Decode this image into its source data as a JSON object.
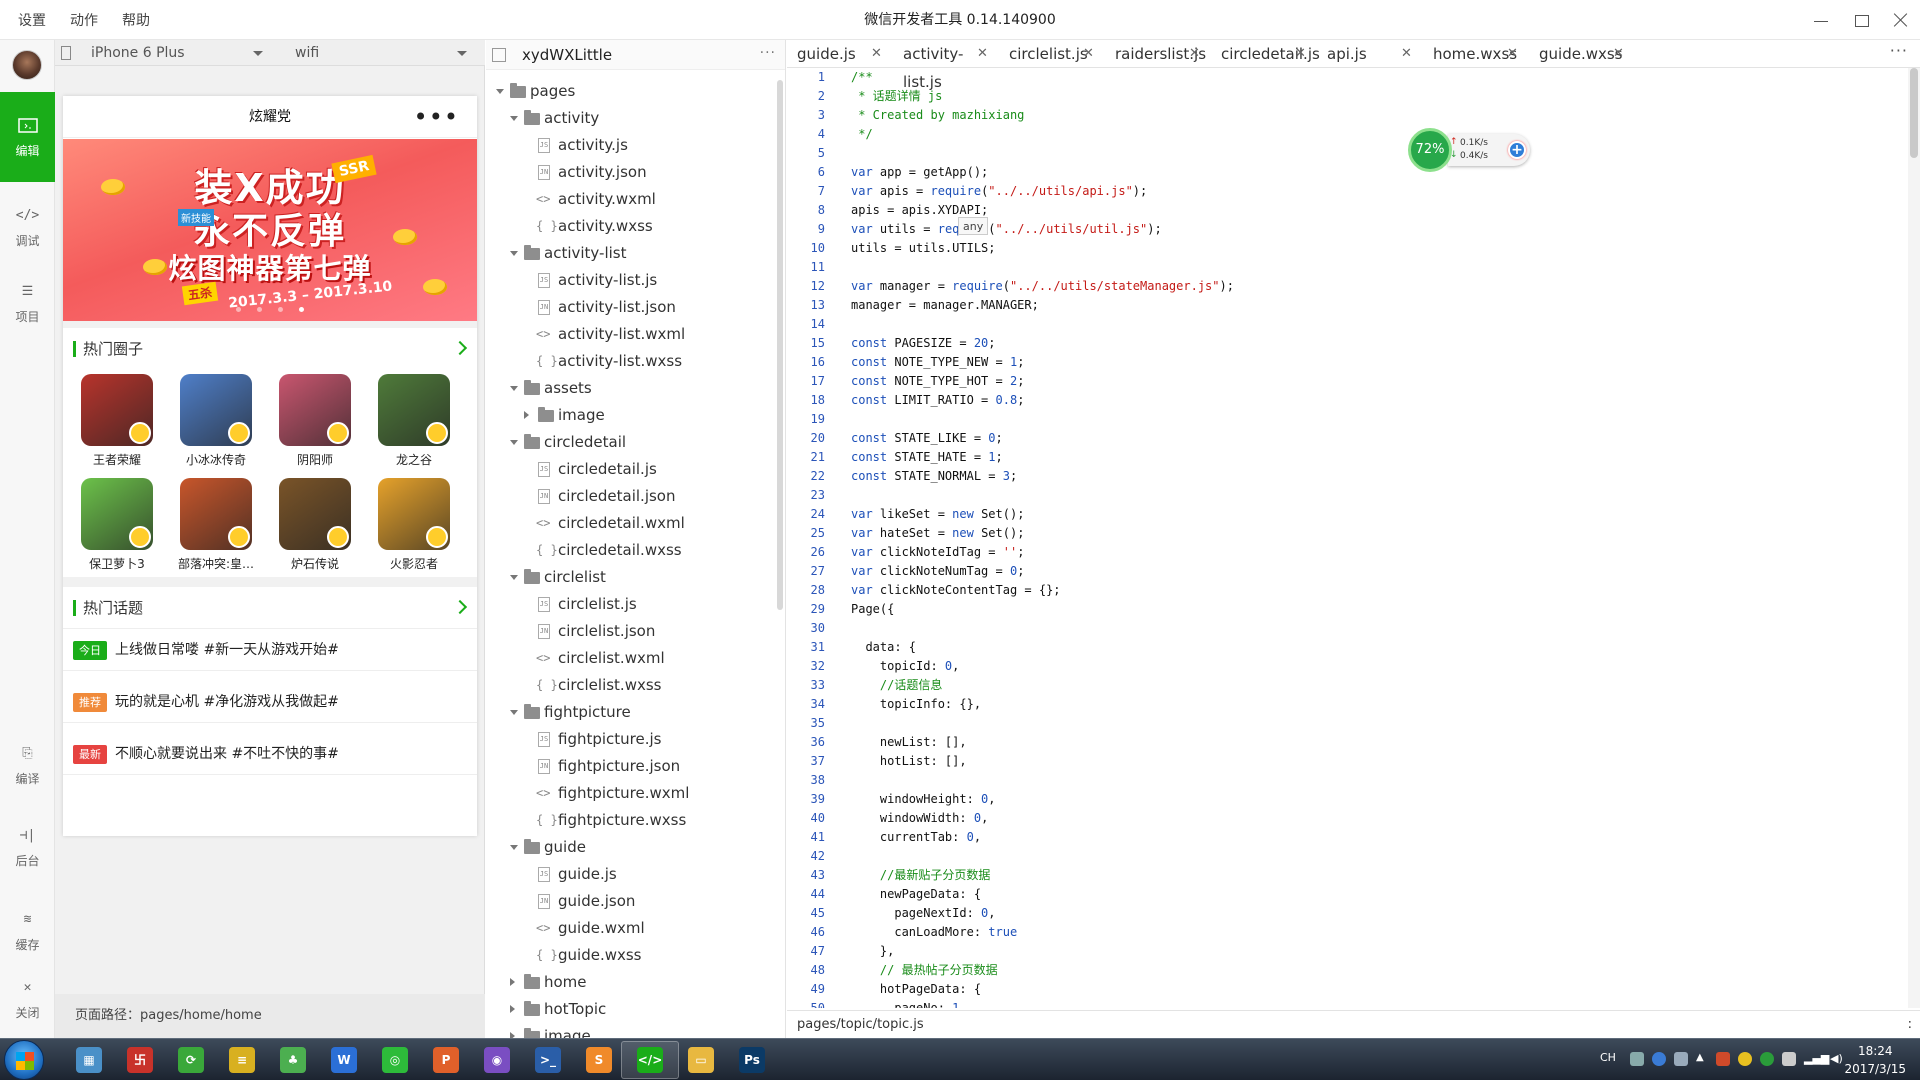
{
  "window": {
    "title": "微信开发者工具 0.14.140900",
    "menus": [
      "设置",
      "动作",
      "帮助"
    ]
  },
  "left_nav": [
    {
      "label": "编辑",
      "icon": "edit-icon",
      "active": true
    },
    {
      "label": "调试",
      "icon": "debug-icon",
      "active": false
    },
    {
      "label": "项目",
      "icon": "project-icon",
      "active": false
    },
    {
      "label": "编译",
      "icon": "compile-icon",
      "active": false
    },
    {
      "label": "后台",
      "icon": "background-icon",
      "active": false
    },
    {
      "label": "缓存",
      "icon": "cache-icon",
      "active": false
    },
    {
      "label": "关闭",
      "icon": "close-icon",
      "active": false
    }
  ],
  "simulator": {
    "device": "iPhone 6 Plus",
    "network": "wifi",
    "page_title": "炫耀党",
    "menu_dots": "•••",
    "banner": {
      "line1": "装X成功",
      "line2": "永不反弹",
      "line3": "炫图神器第七弹",
      "dates": "2017.3.3 – 2017.3.10",
      "badge_ssr": "SSR",
      "badge_five": "五杀",
      "badge_new": "新技能"
    },
    "hot_circles_title": "热门圈子",
    "games": [
      {
        "name": "王者荣耀",
        "color": "#b8342c"
      },
      {
        "name": "小冰冰传奇",
        "color": "#4f7fc9"
      },
      {
        "name": "阴阳师",
        "color": "#c9566f"
      },
      {
        "name": "龙之谷",
        "color": "#4f7b3a"
      },
      {
        "name": "保卫萝卜3",
        "color": "#6cc24a"
      },
      {
        "name": "部落冲突:皇…",
        "color": "#c8562b"
      },
      {
        "name": "炉石传说",
        "color": "#7a5428"
      },
      {
        "name": "火影忍者",
        "color": "#e6a22b"
      }
    ],
    "hot_topics_title": "热门话题",
    "topics": [
      {
        "tag": "今日",
        "tag_color": "#1aad19",
        "text": "上线做日常喽 #新一天从游戏开始#"
      },
      {
        "tag": "推荐",
        "tag_color": "#f08a3a",
        "text": "玩的就是心机 #净化游戏从我做起#"
      },
      {
        "tag": "最新",
        "tag_color": "#e64340",
        "text": "不顺心就要说出来 #不吐不快的事#"
      }
    ],
    "page_path": "页面路径：pages/home/home"
  },
  "file_tree": {
    "project": "xydWXLittle",
    "more": "···",
    "rows": [
      {
        "label": "pages",
        "type": "folder",
        "depth": 0,
        "open": true
      },
      {
        "label": "activity",
        "type": "folder",
        "depth": 1,
        "open": true
      },
      {
        "label": "activity.js",
        "type": "js",
        "depth": 2
      },
      {
        "label": "activity.json",
        "type": "json",
        "depth": 2
      },
      {
        "label": "activity.wxml",
        "type": "wxml",
        "depth": 2
      },
      {
        "label": "activity.wxss",
        "type": "wxss",
        "depth": 2
      },
      {
        "label": "activity-list",
        "type": "folder",
        "depth": 1,
        "open": true
      },
      {
        "label": "activity-list.js",
        "type": "js",
        "depth": 2
      },
      {
        "label": "activity-list.json",
        "type": "json",
        "depth": 2
      },
      {
        "label": "activity-list.wxml",
        "type": "wxml",
        "depth": 2
      },
      {
        "label": "activity-list.wxss",
        "type": "wxss",
        "depth": 2
      },
      {
        "label": "assets",
        "type": "folder",
        "depth": 1,
        "open": true
      },
      {
        "label": "image",
        "type": "folder",
        "depth": 2,
        "open": false
      },
      {
        "label": "circledetail",
        "type": "folder",
        "depth": 1,
        "open": true
      },
      {
        "label": "circledetail.js",
        "type": "js",
        "depth": 2
      },
      {
        "label": "circledetail.json",
        "type": "json",
        "depth": 2
      },
      {
        "label": "circledetail.wxml",
        "type": "wxml",
        "depth": 2
      },
      {
        "label": "circledetail.wxss",
        "type": "wxss",
        "depth": 2
      },
      {
        "label": "circlelist",
        "type": "folder",
        "depth": 1,
        "open": true
      },
      {
        "label": "circlelist.js",
        "type": "js",
        "depth": 2
      },
      {
        "label": "circlelist.json",
        "type": "json",
        "depth": 2
      },
      {
        "label": "circlelist.wxml",
        "type": "wxml",
        "depth": 2
      },
      {
        "label": "circlelist.wxss",
        "type": "wxss",
        "depth": 2
      },
      {
        "label": "fightpicture",
        "type": "folder",
        "depth": 1,
        "open": true
      },
      {
        "label": "fightpicture.js",
        "type": "js",
        "depth": 2
      },
      {
        "label": "fightpicture.json",
        "type": "json",
        "depth": 2
      },
      {
        "label": "fightpicture.wxml",
        "type": "wxml",
        "depth": 2
      },
      {
        "label": "fightpicture.wxss",
        "type": "wxss",
        "depth": 2
      },
      {
        "label": "guide",
        "type": "folder",
        "depth": 1,
        "open": true
      },
      {
        "label": "guide.js",
        "type": "js",
        "depth": 2
      },
      {
        "label": "guide.json",
        "type": "json",
        "depth": 2
      },
      {
        "label": "guide.wxml",
        "type": "wxml",
        "depth": 2
      },
      {
        "label": "guide.wxss",
        "type": "wxss",
        "depth": 2
      },
      {
        "label": "home",
        "type": "folder",
        "depth": 1,
        "open": false
      },
      {
        "label": "hotTopic",
        "type": "folder",
        "depth": 1,
        "open": false
      },
      {
        "label": "image",
        "type": "folder",
        "depth": 1,
        "open": false
      }
    ]
  },
  "editor": {
    "tabs": [
      "guide.js",
      "activity-list.js",
      "circlelist.js",
      "raiderslist.js",
      "circledetail.js",
      "api.js",
      "home.wxss",
      "guide.wxss"
    ],
    "tab_more": "···",
    "tooltip": "any",
    "status_path": "pages/topic/topic.js",
    "status_right": ":",
    "lines": [
      "/**",
      " * 话题详情 js",
      " * Created by mazhixiang",
      " */",
      "",
      "var app = getApp();",
      "var apis = require(\"../../utils/api.js\");",
      "apis = apis.XYDAPI;",
      "var utils = require(\"../../utils/util.js\");",
      "utils = utils.UTILS;",
      "",
      "var manager = require(\"../../utils/stateManager.js\");",
      "manager = manager.MANAGER;",
      "",
      "const PAGESIZE = 20;",
      "const NOTE_TYPE_NEW = 1;",
      "const NOTE_TYPE_HOT = 2;",
      "const LIMIT_RATIO = 0.8;",
      "",
      "const STATE_LIKE = 0;",
      "const STATE_HATE = 1;",
      "const STATE_NORMAL = 3;",
      "",
      "var likeSet = new Set();",
      "var hateSet = new Set();",
      "var clickNoteIdTag = '';",
      "var clickNoteNumTag = 0;",
      "var clickNoteContentTag = {};",
      "Page({",
      "",
      "  data: {",
      "    topicId: 0,",
      "    //话题信息",
      "    topicInfo: {},",
      "",
      "    newList: [],",
      "    hotList: [],",
      "",
      "    windowHeight: 0,",
      "    windowWidth: 0,",
      "    currentTab: 0,",
      "",
      "    //最新贴子分页数据",
      "    newPageData: {",
      "      pageNextId: 0,",
      "      canLoadMore: true",
      "    },",
      "    // 最热帖子分页数据",
      "    hotPageData: {",
      "      pageNo: 1,"
    ]
  },
  "net_widget": {
    "percent": "72%",
    "up": "0.1K/s",
    "down": "0.4K/s"
  },
  "taskbar": {
    "apps": [
      {
        "name": "calculator",
        "color": "#4a90c8",
        "glyph": "▦"
      },
      {
        "name": "app-red",
        "color": "#c8322a",
        "glyph": "卐"
      },
      {
        "name": "app-green-refresh",
        "color": "#3aa83a",
        "glyph": "⟳"
      },
      {
        "name": "notes",
        "color": "#d8b020",
        "glyph": "≡"
      },
      {
        "name": "app-green-leaf",
        "color": "#4caf50",
        "glyph": "♣"
      },
      {
        "name": "word",
        "color": "#2b6fd6",
        "glyph": "W"
      },
      {
        "name": "wechat",
        "color": "#2dbb3a",
        "glyph": "◎"
      },
      {
        "name": "powerpoint",
        "color": "#e0602a",
        "glyph": "P"
      },
      {
        "name": "app-cat",
        "color": "#7a4ec2",
        "glyph": "◉"
      },
      {
        "name": "powershell",
        "color": "#2a5ea8",
        "glyph": ">_"
      },
      {
        "name": "sublime",
        "color": "#f08a2a",
        "glyph": "S"
      },
      {
        "name": "wechat-devtools",
        "color": "#1aad19",
        "glyph": "</>"
      },
      {
        "name": "explorer",
        "color": "#e8b840",
        "glyph": "▭"
      },
      {
        "name": "photoshop",
        "color": "#0b3a66",
        "glyph": "Ps"
      }
    ],
    "ime": "CH",
    "time": "18:24",
    "date": "2017/3/15"
  }
}
